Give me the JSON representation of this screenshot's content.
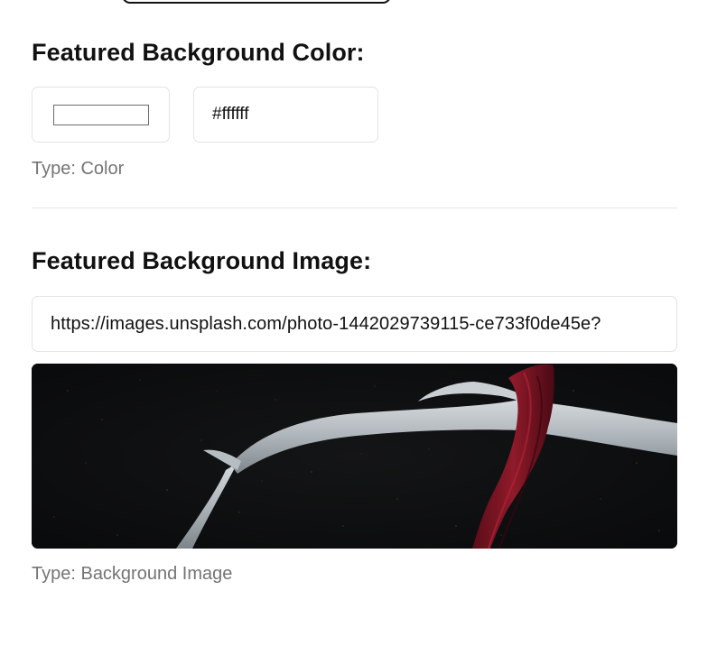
{
  "color_section": {
    "title": "Featured Background Color:",
    "swatch_color": "#ffffff",
    "hex_value": "#ffffff",
    "type_label": "Type: Color"
  },
  "image_section": {
    "title": "Featured Background Image:",
    "url_value": "https://images.unsplash.com/photo-1442029739115-ce733f0de45e?",
    "preview_subject": "white antler tied with red yarn on dark background",
    "type_label": "Type: Background Image"
  }
}
